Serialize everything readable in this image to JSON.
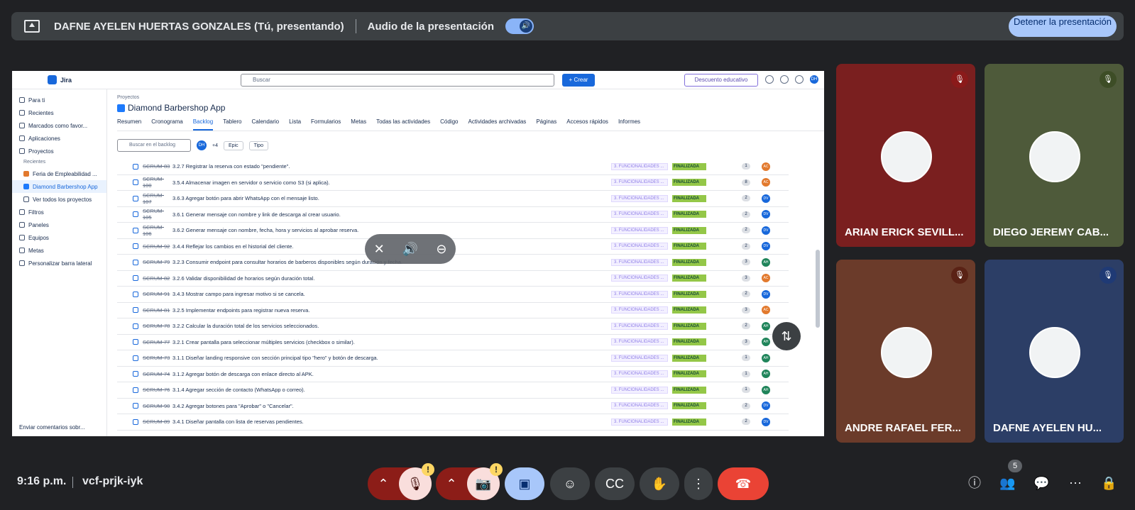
{
  "topbar": {
    "presenter": "DAFNE AYELEN HUERTAS GONZALES (Tú, presentando)",
    "audio_label": "Audio de la presentación",
    "stop_button": "Detener la presentación"
  },
  "jira": {
    "app_name": "Jira",
    "search_placeholder": "Buscar",
    "create_button": "+ Crear",
    "edu_button": "Descuento educativo",
    "avatar": "DH",
    "sidebar": {
      "items": [
        "Para ti",
        "Recientes",
        "Marcados como favor...",
        "Aplicaciones",
        "Proyectos"
      ],
      "recent_label": "Recientes",
      "recent_projects": [
        "Feria de Empleabilidad ...",
        "Diamond Barbershop App"
      ],
      "see_all": "Ver todos los proyectos",
      "bottom_items": [
        "Filtros",
        "Paneles",
        "Equipos",
        "Metas",
        "Personalizar barra lateral"
      ],
      "feedback": "Enviar comentarios sobr..."
    },
    "breadcrumb": "Proyectos",
    "project_title": "Diamond Barbershop App",
    "tabs": [
      "Resumen",
      "Cronograma",
      "Backlog",
      "Tablero",
      "Calendario",
      "Lista",
      "Formularios",
      "Metas",
      "Todas las actividades",
      "Código",
      "Actividades archivadas",
      "Páginas",
      "Accesos rápidos",
      "Informes"
    ],
    "filter_search_placeholder": "Buscar en el backlog",
    "filter_avatar": "DH",
    "filter_more": "+4",
    "filter_epic": "Epic",
    "filter_type": "Tipo",
    "rows": [
      {
        "key": "SCRUM-83",
        "summary": "3.2.7 Registrar la reserva con estado \"pendiente\".",
        "epic": "3. FUNCIONALIDADES ...",
        "status": "FINALIZADA",
        "points": "1",
        "who": "AC",
        "color": "#e2792d"
      },
      {
        "key": "SCRUM-100",
        "summary": "3.5.4 Almacenar imagen en servidor o servicio como S3 (si aplica).",
        "epic": "3. FUNCIONALIDADES ...",
        "status": "FINALIZADA",
        "points": "8",
        "who": "AC",
        "color": "#e2792d"
      },
      {
        "key": "SCRUM-107",
        "summary": "3.6.3 Agregar botón para abrir WhatsApp con el mensaje listo.",
        "epic": "3. FUNCIONALIDADES ...",
        "status": "FINALIZADA",
        "points": "2",
        "who": "DV",
        "color": "#1868db"
      },
      {
        "key": "SCRUM-105",
        "summary": "3.6.1 Generar mensaje con nombre y link de descarga al crear usuario.",
        "epic": "3. FUNCIONALIDADES ...",
        "status": "FINALIZADA",
        "points": "2",
        "who": "DV",
        "color": "#1868db"
      },
      {
        "key": "SCRUM-106",
        "summary": "3.6.2 Generar mensaje con nombre, fecha, hora y servicios al aprobar reserva.",
        "epic": "3. FUNCIONALIDADES ...",
        "status": "FINALIZADA",
        "points": "2",
        "who": "DV",
        "color": "#1868db"
      },
      {
        "key": "SCRUM-92",
        "summary": "3.4.4 Reflejar los cambios en el historial del cliente.",
        "epic": "3. FUNCIONALIDADES ...",
        "status": "FINALIZADA",
        "points": "2",
        "who": "DV",
        "color": "#1868db"
      },
      {
        "key": "SCRUM-79",
        "summary": "3.2.3 Consumir endpoint para consultar horarios de barberos disponibles según duración y fecha.",
        "epic": "3. FUNCIONALIDADES ...",
        "status": "FINALIZADA",
        "points": "3",
        "who": "AH",
        "color": "#1f845a"
      },
      {
        "key": "SCRUM-82",
        "summary": "3.2.6 Validar disponibilidad de horarios según duración total.",
        "epic": "3. FUNCIONALIDADES ...",
        "status": "FINALIZADA",
        "points": "3",
        "who": "AC",
        "color": "#e2792d"
      },
      {
        "key": "SCRUM-91",
        "summary": "3.4.3 Mostrar campo para ingresar motivo si se cancela.",
        "epic": "3. FUNCIONALIDADES ...",
        "status": "FINALIZADA",
        "points": "2",
        "who": "DV",
        "color": "#1868db"
      },
      {
        "key": "SCRUM-81",
        "summary": "3.2.5 Implementar endpoints para registrar nueva reserva.",
        "epic": "3. FUNCIONALIDADES ...",
        "status": "FINALIZADA",
        "points": "3",
        "who": "AC",
        "color": "#e2792d"
      },
      {
        "key": "SCRUM-78",
        "summary": "3.2.2 Calcular la duración total de los servicios seleccionados.",
        "epic": "3. FUNCIONALIDADES ...",
        "status": "FINALIZADA",
        "points": "2",
        "who": "AH",
        "color": "#1f845a"
      },
      {
        "key": "SCRUM-77",
        "summary": "3.2.1 Crear pantalla para seleccionar múltiples servicios (checkbox o similar).",
        "epic": "3. FUNCIONALIDADES ...",
        "status": "FINALIZADA",
        "points": "3",
        "who": "AH",
        "color": "#1f845a"
      },
      {
        "key": "SCRUM-73",
        "summary": "3.1.1 Diseñar landing responsive con sección principal tipo \"hero\" y botón de descarga.",
        "epic": "3. FUNCIONALIDADES ...",
        "status": "FINALIZADA",
        "points": "1",
        "who": "AH",
        "color": "#1f845a"
      },
      {
        "key": "SCRUM-74",
        "summary": "3.1.2 Agregar botón de descarga con enlace directo al APK.",
        "epic": "3. FUNCIONALIDADES ...",
        "status": "FINALIZADA",
        "points": "1",
        "who": "AH",
        "color": "#1f845a"
      },
      {
        "key": "SCRUM-76",
        "summary": "3.1.4 Agregar sección de contacto (WhatsApp o correo).",
        "epic": "3. FUNCIONALIDADES ...",
        "status": "FINALIZADA",
        "points": "1",
        "who": "AH",
        "color": "#1f845a"
      },
      {
        "key": "SCRUM-90",
        "summary": "3.4.2 Agregar botones para \"Aprobar\" o \"Cancelar\".",
        "epic": "3. FUNCIONALIDADES ...",
        "status": "FINALIZADA",
        "points": "2",
        "who": "DV",
        "color": "#1868db"
      },
      {
        "key": "SCRUM-89",
        "summary": "3.4.1 Diseñar pantalla con lista de reservas pendientes.",
        "epic": "3. FUNCIONALIDADES ...",
        "status": "FINALIZADA",
        "points": "2",
        "who": "DV",
        "color": "#1868db"
      }
    ]
  },
  "participants": [
    {
      "name": "ARIAN ERICK SEVILL...",
      "bg": "#7a1f1f",
      "mic_color": "#8b1a1a"
    },
    {
      "name": "DIEGO JEREMY CAB...",
      "bg": "#4e5a3a",
      "mic_color": "#3d4d26"
    },
    {
      "name": "ANDRE RAFAEL FER...",
      "bg": "#6b3b2a",
      "mic_color": "#5a2215"
    },
    {
      "name": "DAFNE AYELEN HU...",
      "bg": "#2c3e66",
      "mic_color": "#1f3a75"
    }
  ],
  "bottombar": {
    "time": "9:16 p.m.",
    "meeting_code": "vcf-prjk-iyk",
    "people_count": "5"
  },
  "colors": {
    "end_call": "#ea4335",
    "present_active": "#a8c7fa",
    "warning": "#fdd663"
  }
}
